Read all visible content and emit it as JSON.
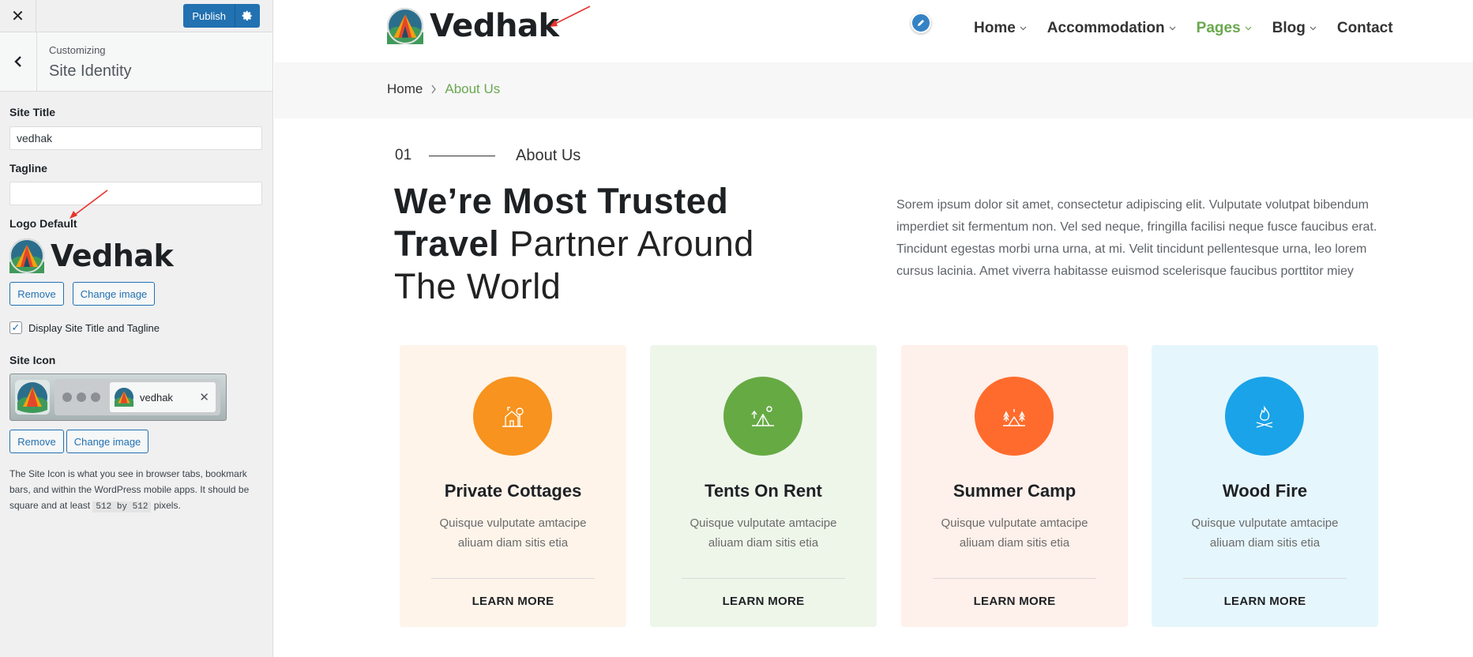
{
  "sidebar": {
    "close_icon": "close-icon",
    "publish_label": "Publish",
    "settings_icon": "gear-icon",
    "customizing_label": "Customizing",
    "section_title": "Site Identity",
    "site_title_label": "Site Title",
    "site_title_value": "vedhak",
    "tagline_label": "Tagline",
    "tagline_value": "",
    "logo_label": "Logo Default",
    "logo_text": "Vedhak",
    "logo_remove": "Remove",
    "logo_change": "Change image",
    "display_title_checkbox_label": "Display Site Title and Tagline",
    "display_title_checked": true,
    "site_icon_label": "Site Icon",
    "site_icon_tab_title": "vedhak",
    "site_icon_remove": "Remove",
    "site_icon_change": "Change image",
    "site_icon_desc_1": "The Site Icon is what you see in browser tabs, bookmark bars, and within the WordPress mobile apps. It should be square and at least",
    "site_icon_code": "512 by 512",
    "site_icon_desc_2": "pixels."
  },
  "preview": {
    "site_name": "Vedhak",
    "nav": [
      {
        "label": "Home",
        "has_dropdown": true
      },
      {
        "label": "Accommodation",
        "has_dropdown": true
      },
      {
        "label": "Pages",
        "has_dropdown": true,
        "active": true
      },
      {
        "label": "Blog",
        "has_dropdown": true
      },
      {
        "label": "Contact",
        "has_dropdown": false
      }
    ],
    "breadcrumb": {
      "home": "Home",
      "current": "About Us"
    },
    "section_number": "01",
    "section_subtitle": "About Us",
    "headline_bold_1": "We’re Most Trusted",
    "headline_bold_2": "Travel",
    "headline_light_2": " Partner Around",
    "headline_light_3": "The World",
    "intro_text": "Sorem ipsum dolor sit amet, consectetur adipiscing elit. Vulputate volutpat bibendum imperdiet sit fermentum non. Vel sed neque, fringilla facilisi neque fusce faucibus erat. Tincidunt egestas morbi urna urna, at mi. Velit tincidunt pellentesque urna, leo lorem cursus lacinia. Amet viverra habitasse euismod scelerisque faucibus porttitor miey",
    "cards": [
      {
        "title": "Private Cottages",
        "desc": "Quisque vulputate amtacipe aliuam diam sitis etia",
        "link": "LEARN MORE",
        "icon": "cottage-icon",
        "bg": "#fef4ea",
        "accent": "#f7931e"
      },
      {
        "title": "Tents On Rent",
        "desc": "Quisque vulputate amtacipe aliuam diam sitis etia",
        "link": "LEARN MORE",
        "icon": "tent-icon",
        "bg": "#eef6ea",
        "accent": "#66aa44"
      },
      {
        "title": "Summer Camp",
        "desc": "Quisque vulputate amtacipe aliuam diam sitis etia",
        "link": "LEARN MORE",
        "icon": "camp-icon",
        "bg": "#fef0ea",
        "accent": "#ff6b2c"
      },
      {
        "title": "Wood Fire",
        "desc": "Quisque vulputate amtacipe aliuam diam sitis etia",
        "link": "LEARN MORE",
        "icon": "campfire-icon",
        "bg": "#e6f6fd",
        "accent": "#1aa3e8"
      }
    ]
  },
  "colors": {
    "wp_blue": "#2271b1",
    "brand_green": "#6aa84f",
    "annotation_red": "#e8322b"
  }
}
